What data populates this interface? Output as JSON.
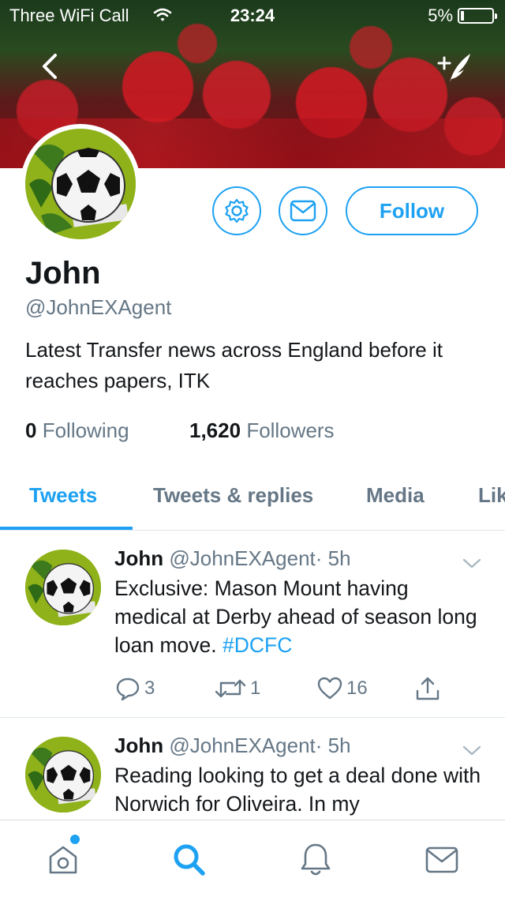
{
  "status_bar": {
    "carrier": "Three WiFi Call",
    "time": "23:24",
    "battery_percent": "5%",
    "battery_level": 0.05
  },
  "header": {
    "back_icon": "chevron-left-icon",
    "compose_icon": "compose-tweet-icon"
  },
  "profile": {
    "name": "John",
    "handle": "@JohnEXAgent",
    "bio": "Latest Transfer news across England before it reaches papers, ITK",
    "following_count": "0",
    "following_label": "Following",
    "followers_count": "1,620",
    "followers_label": "Followers",
    "follow_label": "Follow",
    "settings_icon": "gear-icon",
    "message_icon": "envelope-icon"
  },
  "tabs": [
    {
      "label": "Tweets",
      "active": true
    },
    {
      "label": "Tweets & replies",
      "active": false
    },
    {
      "label": "Media",
      "active": false
    },
    {
      "label": "Lik",
      "active": false
    }
  ],
  "tweets": [
    {
      "name": "John",
      "handle": "@JohnEXAgent",
      "time": "· 5h",
      "text": "Exclusive: Mason Mount having medical at Derby ahead of season long loan move.",
      "hashtag": "#DCFC",
      "replies": "3",
      "retweets": "1",
      "likes": "16"
    },
    {
      "name": "John",
      "handle": "@JohnEXAgent",
      "time": "· 5h",
      "text": "Reading looking to get a deal done with Norwich for Oliveira. In my"
    }
  ],
  "tabbar": {
    "items": [
      "home-icon",
      "search-icon",
      "notifications-bell-icon",
      "messages-envelope-icon"
    ],
    "active": "search-icon",
    "accent": "#1da1f2"
  },
  "colors": {
    "accent": "#1da1f2",
    "secondary_text": "#657786",
    "primary_text": "#14171a",
    "avatar_green": "#8fb21a"
  }
}
